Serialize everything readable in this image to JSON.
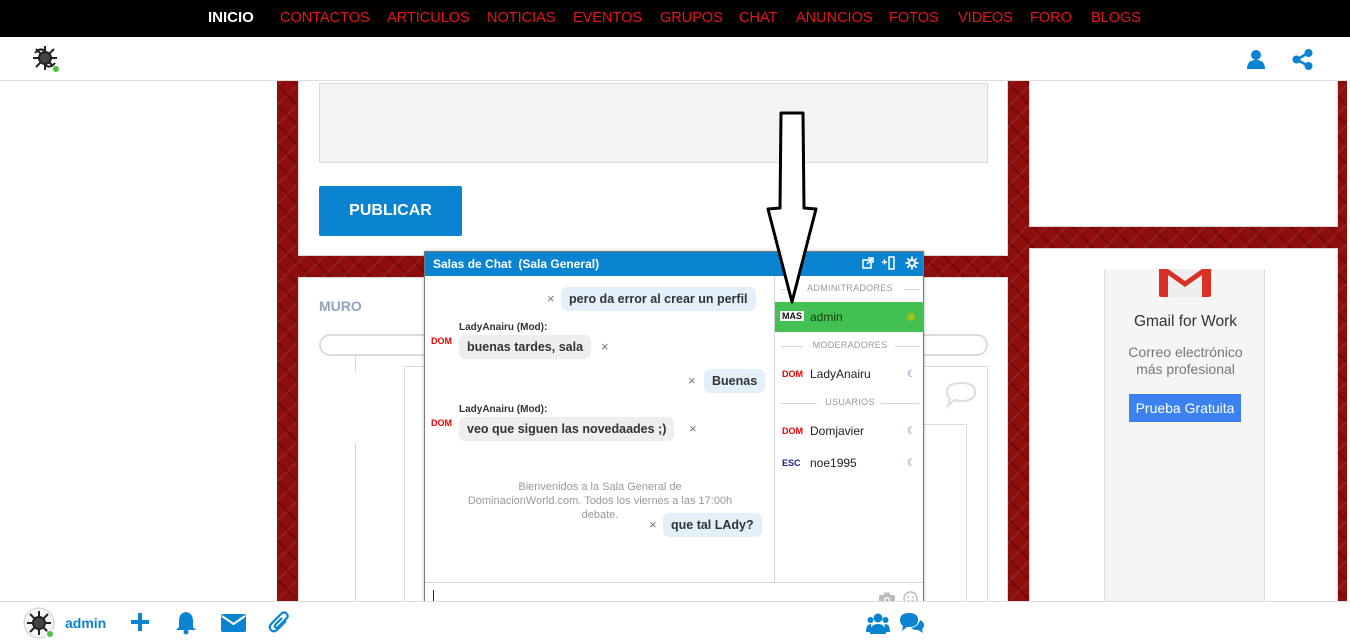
{
  "nav": {
    "items": [
      "INICIO",
      "CONTACTOS",
      "ARTICULOS",
      "NOTICIAS",
      "EVENTOS",
      "GRUPOS",
      "CHAT",
      "ANUNCIOS",
      "FOTOS",
      "VIDEOS",
      "FORO",
      "BLOGS"
    ],
    "active": "INICIO"
  },
  "header": {
    "logo_icon": "tribal-logo-icon",
    "icons": [
      "user-icon",
      "share-icon"
    ]
  },
  "post_form": {
    "publish_label": "PUBLICAR"
  },
  "wall": {
    "title": "MURO"
  },
  "ad": {
    "title": "Gmail for Work",
    "subtitle_line1": "Correo electrónico",
    "subtitle_line2": "más profesional",
    "button": "Prueba Gratuita"
  },
  "chat": {
    "title": "Salas de Chat  (Sala General)",
    "messages": [
      {
        "text": "pero da error al crear un perfil",
        "own": true
      },
      {
        "sender": "LadyAnairu (Mod):",
        "role": "DOM",
        "text": "buenas tardes, sala",
        "own": false
      },
      {
        "text": "Buenas",
        "own": true
      },
      {
        "sender": "LadyAnairu (Mod):",
        "role": "DOM",
        "text": "veo que siguen las novedaades ;)",
        "own": false
      },
      {
        "text": "que tal LAdy?",
        "own": true
      }
    ],
    "welcome_line1": "Bienvenidos a la Sala General de",
    "welcome_line2": "DominacionWorld.com. Todos los viernes a las 17:00h",
    "welcome_line3": "debate.",
    "sections": {
      "admins": "ADMINITRADORES",
      "mods": "MODERADORES",
      "users": "USUARIOS"
    },
    "admins": [
      {
        "role": "MAS",
        "name": "admin"
      }
    ],
    "mods": [
      {
        "role": "DOM",
        "name": "LadyAnairu"
      }
    ],
    "users": [
      {
        "role": "DOM",
        "name": "Domjavier"
      },
      {
        "role": "ESC",
        "name": "noe1995"
      }
    ]
  },
  "bottombar": {
    "username": "admin"
  },
  "colors": {
    "accent": "#0a84d0",
    "nav_red": "#e8141b",
    "online_green": "#42c152",
    "bg_red": "#8e0d0d"
  }
}
